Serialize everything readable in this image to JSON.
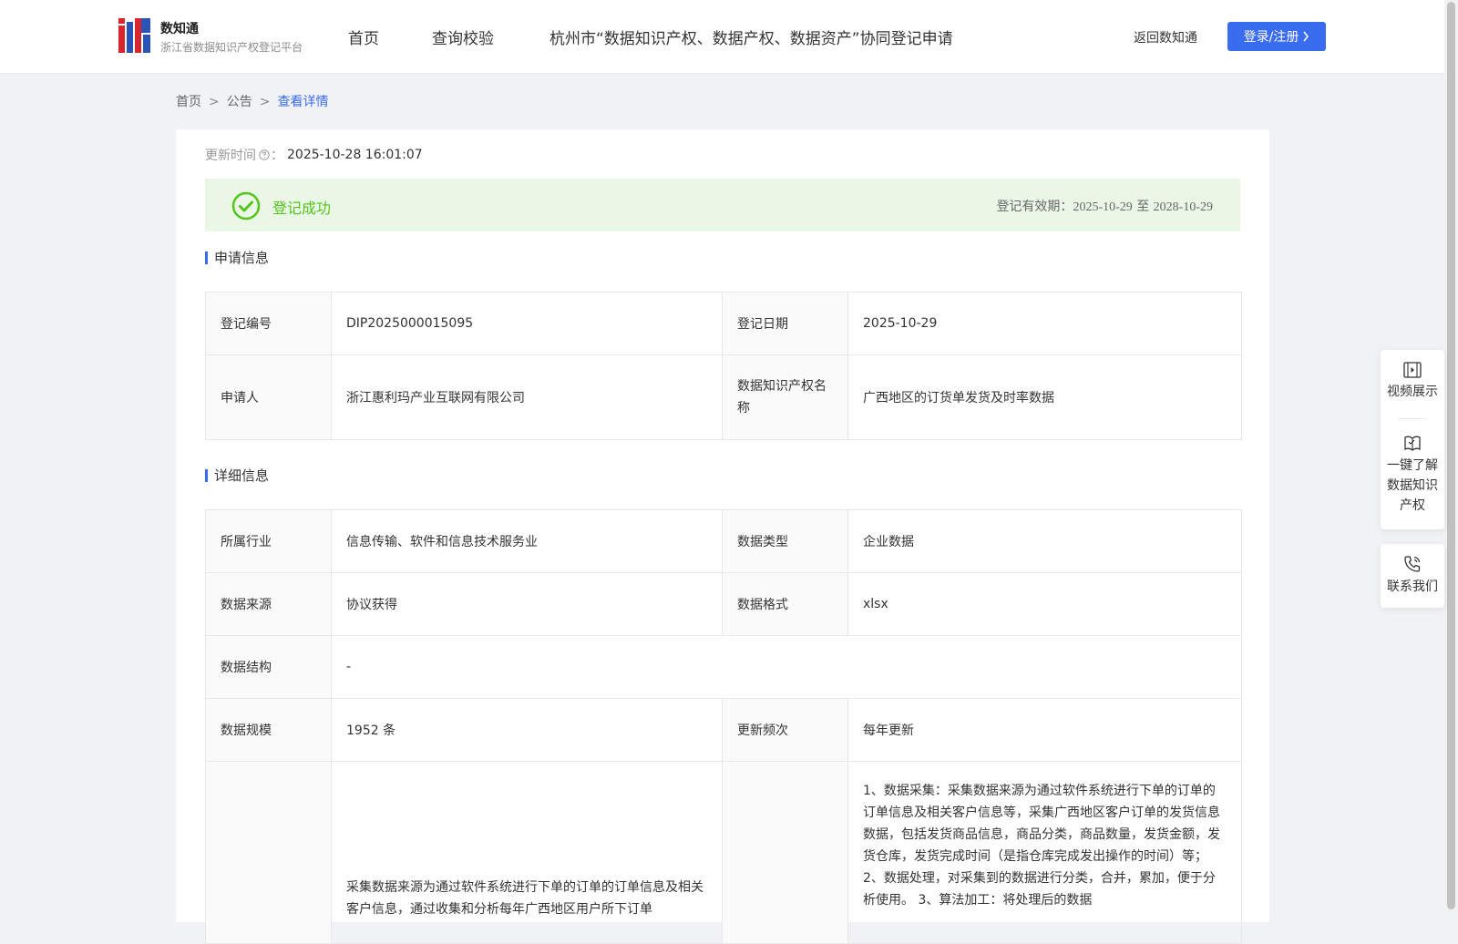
{
  "header": {
    "logo_name": "数知通",
    "logo_subtitle": "浙江省数据知识产权登记平台",
    "nav": [
      "首页",
      "查询校验",
      "杭州市“数据知识产权、数据产权、数据资产”协同登记申请"
    ],
    "back_link": "返回数知通",
    "login_label": "登录/注册"
  },
  "breadcrumb": [
    "首页",
    "公告",
    "查看详情"
  ],
  "update": {
    "label": "更新时间",
    "value": "2025-10-28 16:01:07"
  },
  "status": {
    "text": "登记成功",
    "validity_label": "登记有效期：",
    "validity_start": "2025-10-29",
    "validity_sep": "至",
    "validity_end": "2028-10-29",
    "color": "#52c41a"
  },
  "application": {
    "title": "申请信息",
    "reg_no_label": "登记编号",
    "reg_no": "DIP2025000015095",
    "reg_date_label": "登记日期",
    "reg_date": "2025-10-29",
    "applicant_label": "申请人",
    "applicant": "浙江惠利玛产业互联网有限公司",
    "ip_name_label": "数据知识产权名称",
    "ip_name": "广西地区的订货单发货及时率数据"
  },
  "detail": {
    "title": "详细信息",
    "industry_label": "所属行业",
    "industry": "信息传输、软件和信息技术服务业",
    "data_type_label": "数据类型",
    "data_type": "企业数据",
    "source_label": "数据来源",
    "source": "协议获得",
    "format_label": "数据格式",
    "format": "xlsx",
    "structure_label": "数据结构",
    "structure": "-",
    "scale_label": "数据规模",
    "scale": "1952 条",
    "frequency_label": "更新频次",
    "frequency": "每年更新",
    "desc_left": "采集数据来源为通过软件系统进行下单的订单的订单信息及相关客户信息，通过收集和分析每年广西地区用户所下订单",
    "desc_right": "1、数据采集：采集数据来源为通过软件系统进行下单的订单的订单信息及相关客户信息等，采集广西地区客户订单的发货信息数据，包括发货商品信息，商品分类，商品数量，发货金额，发货仓库，发货完成时间（是指仓库完成发出操作的时间）等； 2、数据处理，对采集到的数据进行分类，合并，累加，便于分析使用。 3、算法加工：将处理后的数据"
  },
  "float_bar": {
    "video": "视频展示",
    "learn": "一键了解数据知识产权",
    "contact": "联系我们"
  },
  "colors": {
    "primary": "#3a6cf0",
    "success": "#52c41a",
    "success_bg": "#ebf7e6",
    "logo_red": "#d7262e",
    "logo_blue": "#2a55b8"
  }
}
